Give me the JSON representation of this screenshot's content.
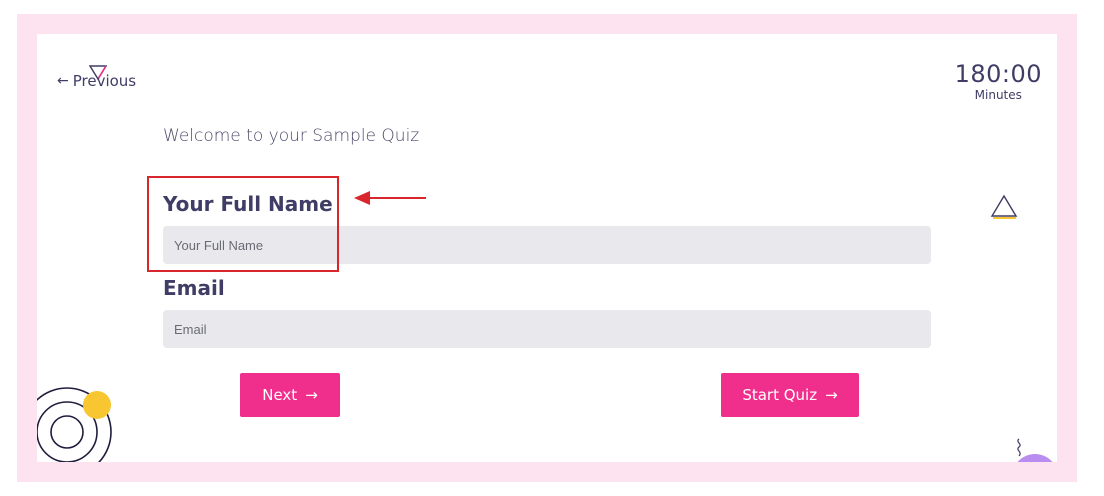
{
  "nav": {
    "previous_label": "Previous",
    "previous_arrow": "←"
  },
  "timer": {
    "value": "180:00",
    "unit": "Minutes"
  },
  "quiz": {
    "welcome": "Welcome to your Sample Quiz"
  },
  "form": {
    "name_label": "Your Full Name",
    "name_placeholder": "Your Full Name",
    "name_value": "",
    "email_label": "Email",
    "email_placeholder": "Email",
    "email_value": ""
  },
  "buttons": {
    "next_label": "Next",
    "start_label": "Start Quiz",
    "arrow": "→"
  },
  "colors": {
    "frame": "#fde2ef",
    "accent": "#f02e8c",
    "text": "#3f3d66",
    "input_bg": "#e8e8ed",
    "annotation": "#d8262c",
    "deco_yellow": "#f8c630",
    "deco_purple": "#b98cf0"
  },
  "icons": [
    "arrow-left-icon",
    "arrow-right-icon",
    "triangle-decoration-icon",
    "concentric-circles-decoration-icon",
    "squiggle-decoration-icon"
  ]
}
